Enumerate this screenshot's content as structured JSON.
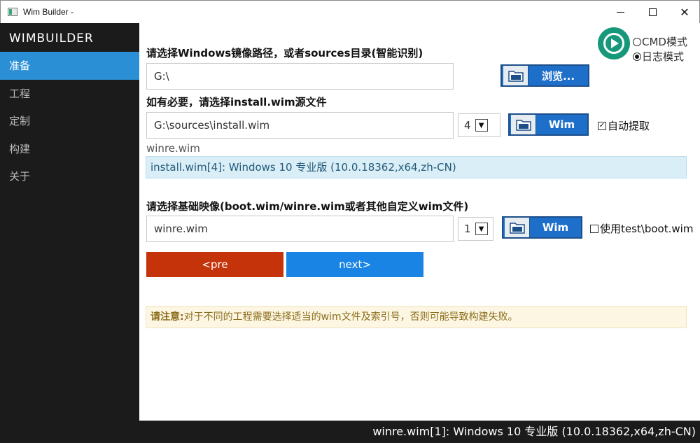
{
  "window": {
    "title": "Wim Builder -"
  },
  "sidebar": {
    "brand": "WIMBUILDER",
    "items": [
      {
        "label": "准备",
        "active": true
      },
      {
        "label": "工程",
        "active": false
      },
      {
        "label": "定制",
        "active": false
      },
      {
        "label": "构建",
        "active": false
      },
      {
        "label": "关于",
        "active": false
      }
    ]
  },
  "mode": {
    "icon": "play-circle-icon",
    "options": [
      {
        "label": "CMD模式",
        "selected": false
      },
      {
        "label": "日志模式",
        "selected": true
      }
    ]
  },
  "source": {
    "label": "请选择Windows镜像路径，或者sources目录(智能识别)",
    "value": "G:\\",
    "browse_label": "浏览..."
  },
  "install": {
    "label": "如有必要，请选择install.wim源文件",
    "value": "G:\\sources\\install.wim",
    "index": "4",
    "button_label": "Wim",
    "auto_extract_label": "自动提取",
    "auto_extract_checked": true
  },
  "hint_text": "winre.wim",
  "info_text": "install.wim[4]: Windows 10 专业版 (10.0.18362,x64,zh-CN)",
  "base": {
    "label": "请选择基础映像(boot.wim/winre.wim或者其他自定义wim文件)",
    "value": "winre.wim",
    "index": "1",
    "button_label": "Wim",
    "use_test_label": "使用test\\boot.wim",
    "use_test_checked": false
  },
  "buttons": {
    "pre": "<pre",
    "next": "next>"
  },
  "warning": {
    "prefix": "请注意:",
    "text": "对于不同的工程需要选择适当的wim文件及索引号，否则可能导致构建失败。"
  },
  "status_text": "winre.wim[1]: Windows 10 专业版 (10.0.18362,x64,zh-CN)",
  "colors": {
    "sidebar_bg": "#1b1b1b",
    "accent": "#2b8fd6",
    "pre_button": "#c43309",
    "next_button": "#1a84e5",
    "info_bg": "#d9eef7",
    "warning_bg": "#fdf6e3"
  }
}
